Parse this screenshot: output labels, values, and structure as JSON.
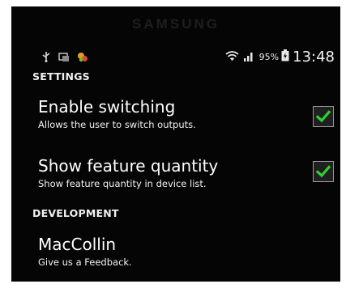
{
  "device": {
    "brand": "SAMSUNG"
  },
  "status": {
    "icons": [
      "usb-icon",
      "screenshot-icon",
      "app-notification-icon"
    ],
    "right_icons": [
      "wifi-icon",
      "signal-icon",
      "battery-icon"
    ],
    "battery": "95%",
    "time": "13:48"
  },
  "settings": {
    "category": "SETTINGS",
    "items": [
      {
        "title": "Enable switching",
        "summary": "Allows the user to switch outputs.",
        "checked": true
      },
      {
        "title": "Show feature quantity",
        "summary": "Show feature quantity in device list.",
        "checked": true
      }
    ]
  },
  "development": {
    "category": "DEVELOPMENT",
    "items": [
      {
        "title": "MacCollin",
        "summary": "Give us a Feedback."
      }
    ]
  },
  "colors": {
    "check": "#2fd02f",
    "background": "#050505"
  }
}
